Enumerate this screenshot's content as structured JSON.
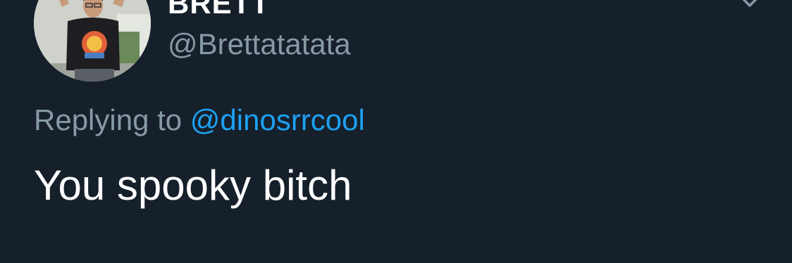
{
  "tweet": {
    "author": {
      "display_name": "BRETT",
      "handle": "@Brettatatata"
    },
    "reply": {
      "prefix": "Replying to",
      "mention": "@dinosrrcool"
    },
    "text": "You spooky bitch",
    "menu_icon": "chevron-down-icon"
  },
  "colors": {
    "background": "#15202b",
    "primary_text": "#ffffff",
    "secondary_text": "#8899a6",
    "accent": "#1da1f2"
  }
}
